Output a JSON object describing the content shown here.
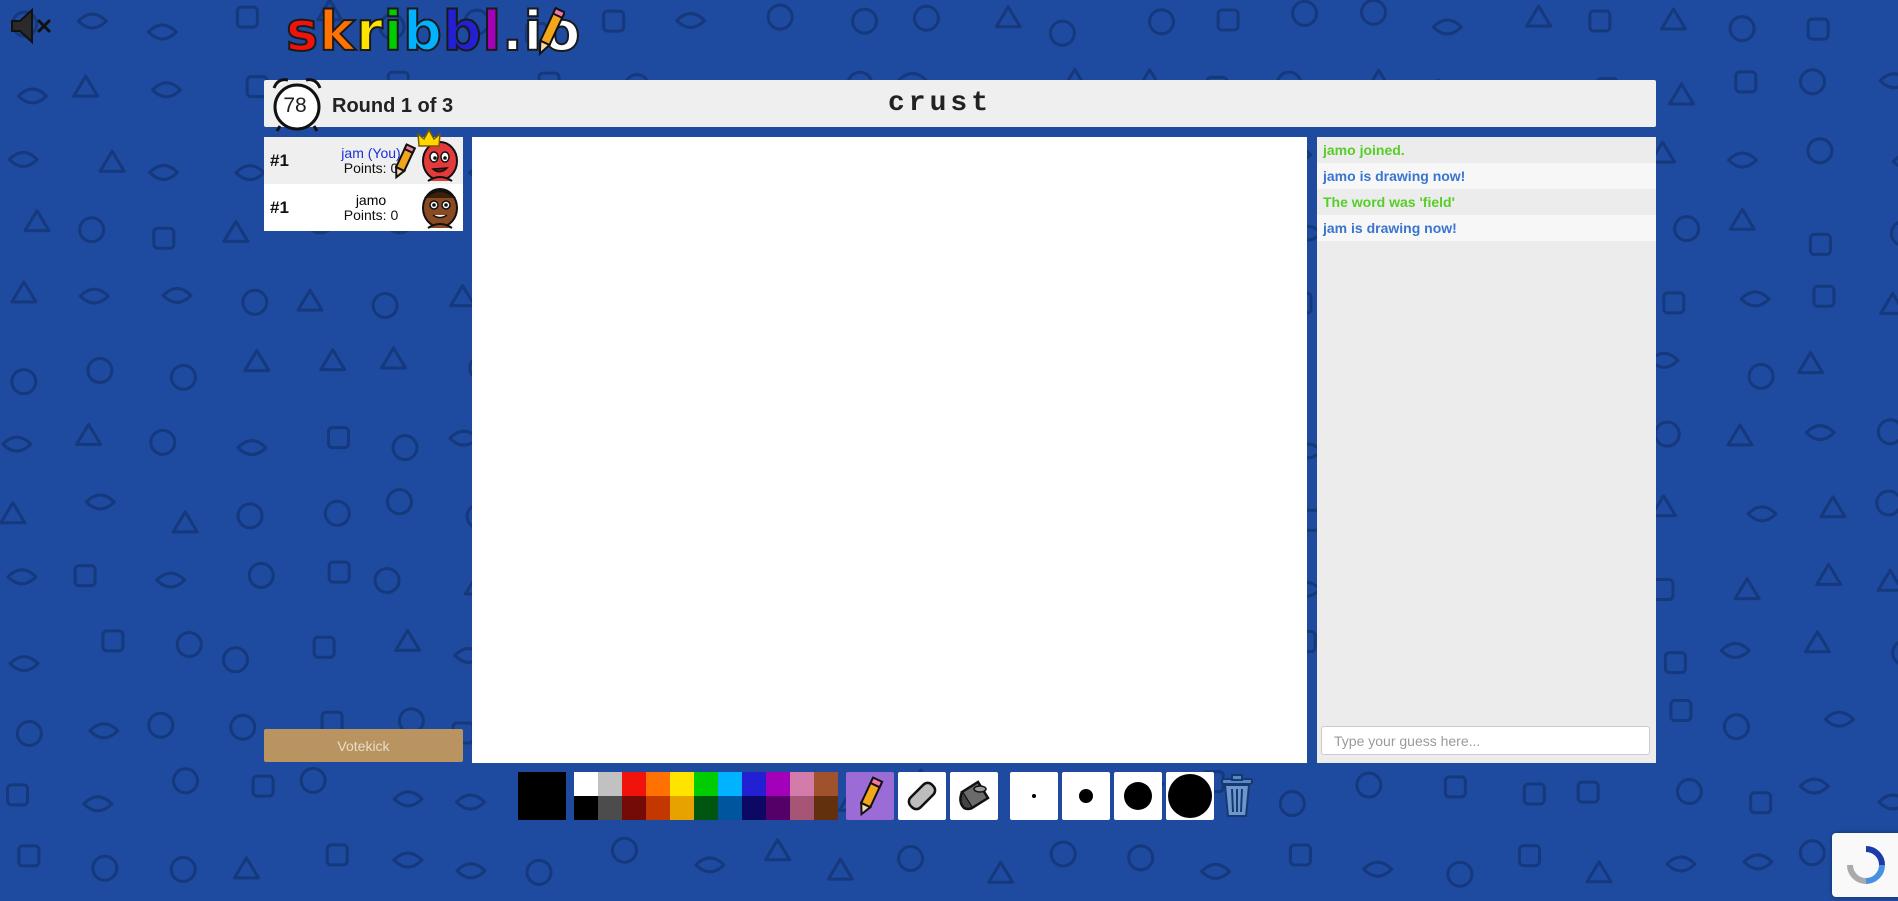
{
  "header": {
    "timer": "78",
    "round_text": "Round 1 of 3",
    "word": "crust"
  },
  "logo": {
    "letters": [
      "s",
      "k",
      "r",
      "i",
      "b",
      "b",
      "l",
      ".",
      "i",
      "o"
    ]
  },
  "players": [
    {
      "rank": "#1",
      "name": "jam (You)",
      "points": "Points: 0",
      "is_you": true,
      "drawing": true,
      "owner": true
    },
    {
      "rank": "#1",
      "name": "jamo",
      "points": "Points: 0",
      "is_you": false,
      "drawing": false,
      "owner": false
    }
  ],
  "votekick": {
    "label": "Votekick"
  },
  "chat": {
    "messages": [
      {
        "text": "jamo joined.",
        "color": "#56ce27"
      },
      {
        "text": "jamo is drawing now!",
        "color": "#3975ce"
      },
      {
        "text": "The word was 'field'",
        "color": "#56ce27"
      },
      {
        "text": "jam is drawing now!",
        "color": "#3975ce"
      }
    ],
    "input_placeholder": "Type your guess here..."
  },
  "toolbar": {
    "current_color": "#000000",
    "palette_top": [
      "#ffffff",
      "#c1c1c1",
      "#ef130b",
      "#ff7100",
      "#ffe400",
      "#00cc00",
      "#00b2ff",
      "#231fd3",
      "#a300ba",
      "#d37caa",
      "#a0522d"
    ],
    "palette_bottom": [
      "#000000",
      "#4c4c4c",
      "#740b07",
      "#c23800",
      "#e8a200",
      "#005510",
      "#00569e",
      "#0e0865",
      "#550069",
      "#a75574",
      "#63300d"
    ],
    "tools": [
      "pencil-icon",
      "eraser-icon",
      "fill-bucket-icon"
    ],
    "active_tool": "pencil-icon",
    "brush_sizes": [
      "small",
      "medium",
      "large",
      "extra-large"
    ]
  },
  "colors": {
    "background": "#1e4ba0",
    "panel": "#efefef",
    "votekick": "#b99461",
    "active_tool": "#9b6bd6"
  }
}
